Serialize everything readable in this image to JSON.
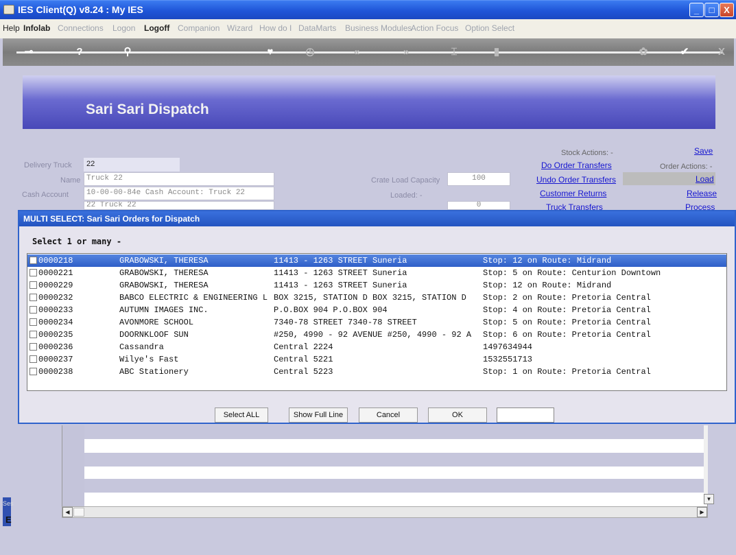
{
  "window": {
    "title": "IES Client(Q) v8.24 : My IES",
    "min": "_",
    "max": "□",
    "close": "X"
  },
  "menu": [
    {
      "label": "Help",
      "state": "on"
    },
    {
      "label": "Infolab",
      "state": "bold"
    },
    {
      "label": "Connections",
      "state": "off"
    },
    {
      "label": "Logon",
      "state": "off"
    },
    {
      "label": "Logoff",
      "state": "bold"
    },
    {
      "label": "Companion",
      "state": "off"
    },
    {
      "label": "Wizard",
      "state": "off"
    },
    {
      "label": "How do I",
      "state": "off"
    },
    {
      "label": "DataMarts",
      "state": "off"
    },
    {
      "label": "Business Modules",
      "state": "off"
    },
    {
      "label": "Action Focus",
      "state": "off"
    },
    {
      "label": "Option Select",
      "state": "off"
    }
  ],
  "toolbar": {
    "glyphs": [
      "⊸",
      "?",
      "⚲",
      "♥",
      "◷",
      "«",
      "»",
      "⌶",
      "▮",
      "✿",
      "✔",
      "X"
    ]
  },
  "page": {
    "title": "Sari Sari Dispatch",
    "delivery_truck_label": "Delivery Truck",
    "delivery_truck_value": "22",
    "name_label": "Name",
    "name_value": "Truck 22",
    "cash_account_label": "Cash Account",
    "cash_account_value": "10-00-00-84e Cash Account: Truck 22",
    "hidden_row_value": "22 Truck 22",
    "crate_label": "Crate Load Capacity",
    "crate_value": "100",
    "loaded_label": "Loaded: -",
    "loaded_value": "0",
    "stock_actions_label": "Stock Actions: -",
    "stock_links": [
      "Do Order Transfers",
      "Undo Order Transfers",
      "Customer Returns",
      "Truck Transfers"
    ],
    "save": "Save",
    "order_actions_label": "Order Actions: -",
    "order_links": [
      "Load",
      "Release",
      "Process"
    ],
    "side_text": "Ses",
    "side_char": "E"
  },
  "dialog": {
    "title": "MULTI SELECT: Sari Sari Orders for Dispatch",
    "subtitle": "Select 1 or many -",
    "rows": [
      {
        "id": "0000218",
        "name": "GRABOWSKI, THERESA",
        "address": "11413 - 1263 STREET Suneria",
        "info": "Stop: 12 on Route: Midrand",
        "selected": true
      },
      {
        "id": "0000221",
        "name": "GRABOWSKI, THERESA",
        "address": "11413 - 1263 STREET Suneria",
        "info": "Stop: 5 on Route: Centurion Downtown"
      },
      {
        "id": "0000229",
        "name": "GRABOWSKI, THERESA",
        "address": "11413 - 1263 STREET Suneria",
        "info": "Stop: 12 on Route: Midrand"
      },
      {
        "id": "0000232",
        "name": "BABCO ELECTRIC & ENGINEERING L",
        "address": "BOX 3215, STATION D BOX 3215, STATION D",
        "info": "Stop: 2 on Route: Pretoria Central"
      },
      {
        "id": "0000233",
        "name": "AUTUMN IMAGES INC.",
        "address": "P.O.BOX 904 P.O.BOX 904",
        "info": "Stop: 4 on Route: Pretoria Central"
      },
      {
        "id": "0000234",
        "name": "AVONMORE SCHOOL",
        "address": "7340-78 STREET 7340-78 STREET",
        "info": "Stop: 5 on Route: Pretoria Central"
      },
      {
        "id": "0000235",
        "name": "DOORNKLOOF SUN",
        "address": "#250, 4990 - 92 AVENUE #250, 4990 - 92 A",
        "info": "Stop: 6 on Route: Pretoria Central"
      },
      {
        "id": "0000236",
        "name": "Cassandra",
        "address": "Central 2224",
        "info": "1497634944"
      },
      {
        "id": "0000237",
        "name": "Wilye's Fast",
        "address": "Central 5221",
        "info": "1532551713"
      },
      {
        "id": "0000238",
        "name": "ABC Stationery",
        "address": "Central 5223",
        "info": "Stop: 1 on Route: Pretoria Central"
      }
    ],
    "buttons": {
      "select_all": "Select ALL",
      "show_full_line": "Show Full Line",
      "cancel": "Cancel",
      "ok": "OK"
    },
    "input_value": ""
  }
}
